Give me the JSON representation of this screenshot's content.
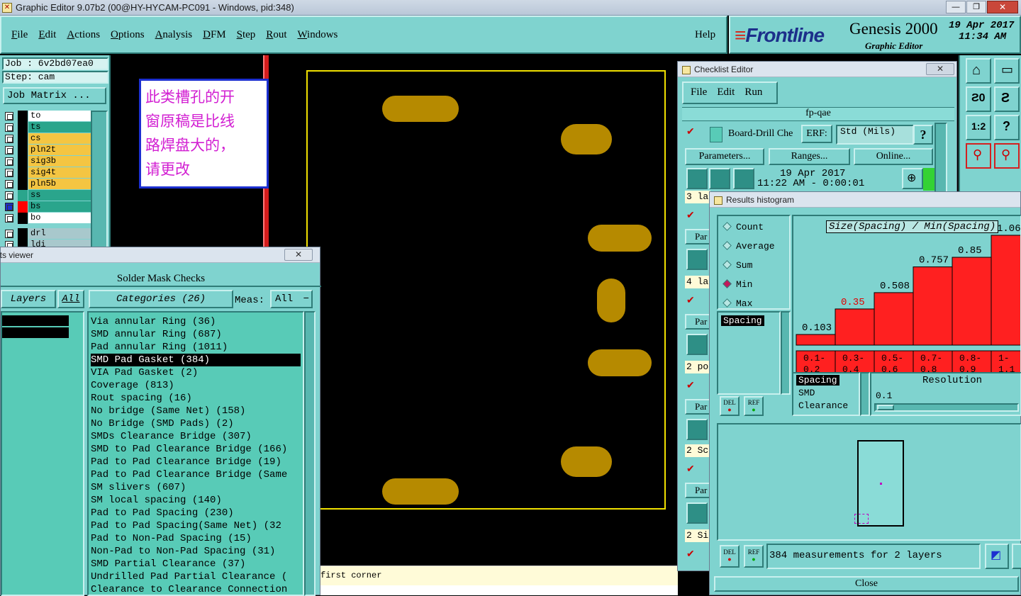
{
  "titlebar": {
    "title": "Graphic Editor 9.07b2 (00@HY-HYCAM-PC091 - Windows, pid:348)"
  },
  "menu": {
    "items": [
      "File",
      "Edit",
      "Actions",
      "Options",
      "Analysis",
      "DFM",
      "Step",
      "Rout",
      "Windows"
    ],
    "help": "Help"
  },
  "brand": {
    "logo": "Frontline",
    "product": "Genesis 2000",
    "subtitle": "Graphic Editor",
    "date": "19 Apr 2017",
    "time": "11:34 AM"
  },
  "job": {
    "job_label": "Job : 6v2bd07ea0",
    "step_label": "Step: cam",
    "matrix_button": "Job Matrix ..."
  },
  "layers": [
    {
      "name": "to",
      "color": "#ffffff",
      "swatch": "#000000"
    },
    {
      "name": "ts",
      "color": "#2aa58c",
      "swatch": "#000000"
    },
    {
      "name": "cs",
      "color": "#f4c542",
      "swatch": "#000000"
    },
    {
      "name": "pln2t",
      "color": "#f4c542",
      "swatch": "#000000"
    },
    {
      "name": "sig3b",
      "color": "#f4c542",
      "swatch": "#000000"
    },
    {
      "name": "sig4t",
      "color": "#f4c542",
      "swatch": "#000000"
    },
    {
      "name": "pln5b",
      "color": "#f4c542",
      "swatch": "#000000"
    },
    {
      "name": "ss",
      "color": "#2aa58c",
      "swatch": "#2aa58c"
    },
    {
      "name": "bs",
      "color": "#2aa58c",
      "swatch": "#ff0000"
    },
    {
      "name": "bo",
      "color": "#ffffff",
      "swatch": "#000000"
    },
    {
      "name": "drl",
      "color": "#a8c8cc",
      "swatch": "#000000"
    },
    {
      "name": "ldi",
      "color": "#a8c8cc",
      "swatch": "#000000"
    }
  ],
  "note": {
    "lines": [
      "此类槽孔的开",
      "窗原稿是比线",
      "路焊盘大的，",
      "请更改"
    ]
  },
  "results_viewer": {
    "title": "lts viewer",
    "header": "Solder Mask Checks",
    "layers_label": "Layers",
    "all_label": "All",
    "categories_label": "Categories (26)",
    "meas_label": "Meas:",
    "meas_value": "All",
    "categories": [
      "Via annular Ring (36)",
      "SMD annular Ring (687)",
      "Pad annular Ring (1011)",
      "SMD Pad Gasket (384)",
      "VIA Pad Gasket (2)",
      "Coverage (813)",
      "Rout spacing (16)",
      "No bridge (Same Net) (158)",
      "No Bridge (SMD Pads) (2)",
      "SMDs Clearance Bridge (307)",
      "SMD to Pad Clearance Bridge (166)",
      "Pad to Pad Clearance Bridge (19)",
      "Pad to Pad Clearance Bridge (Same",
      "SM slivers (607)",
      "SM local spacing (140)",
      "Pad to Pad Spacing (230)",
      "Pad to Pad Spacing(Same Net) (32",
      "Pad to Non-Pad Spacing (15)",
      "Non-Pad to Non-Pad Spacing (31)",
      "SMD Partial Clearance (37)",
      "Undrilled Pad Partial Clearance (",
      "Clearance to Clearance Connection"
    ],
    "selected_index": 3
  },
  "status": {
    "prompt": "first corner"
  },
  "checklist": {
    "title": "Checklist Editor",
    "menu": [
      "File",
      "Edit",
      "Run"
    ],
    "name": "fp-qae",
    "action": "Board-Drill Che",
    "erf_label": "ERF:",
    "erf_value": "Std (Mils)",
    "help": "?",
    "buttons": [
      "Parameters...",
      "Ranges...",
      "Online..."
    ],
    "date": "19 Apr 2017",
    "time": "11:22 AM - 0:00:01",
    "rows": [
      "3 la",
      "Par",
      "4 la",
      "Par",
      "2 po",
      "Par",
      "2 Sc",
      "Par",
      "2 Si"
    ]
  },
  "histogram": {
    "title": "Results histogram",
    "modes": [
      "Count",
      "Average",
      "Sum",
      "Min",
      "Max"
    ],
    "selected_mode": "Min",
    "chart_title": "Size(Spacing) / Min(Spacing)",
    "types": [
      "Spacing"
    ],
    "types_bottom": [
      "Spacing",
      "SMD",
      "Clearance"
    ],
    "resolution_label": "Resolution",
    "resolution_value": "0.1",
    "del": "DEL",
    "ref": "REF",
    "summary": "384 measurements for 2 layers",
    "close": "Close"
  },
  "chart_data": {
    "type": "bar",
    "title": "Size(Spacing) / Min(Spacing)",
    "categories": [
      "0.1-\n0.2",
      "0.3-\n0.4",
      "0.5-\n0.6",
      "0.7-\n0.8",
      "0.8-\n0.9",
      "1-\n1.1"
    ],
    "values": [
      0.103,
      0.35,
      0.508,
      0.757,
      0.85,
      1.063
    ],
    "value_labels": [
      "0.103",
      "0.35",
      "0.508",
      "0.757",
      "0.85",
      "1.06"
    ],
    "highlight_index": 1,
    "bar_color": "#ff2020",
    "ylim": [
      0,
      1.2
    ]
  },
  "colors": {
    "panel": "#7fd3cf",
    "list_bg": "#58cbb7",
    "pad": "#b68a00",
    "frame": "#f0e000"
  }
}
